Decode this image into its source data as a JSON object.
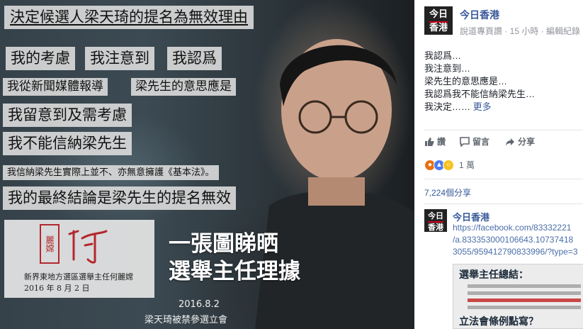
{
  "photo": {
    "title": "決定候選人梁天琦的提名為無效理由",
    "captions": [
      "我的考慮",
      "我注意到",
      "我認爲",
      "我從新聞媒體報導",
      "梁先生的意思應是",
      "我留意到及需考慮",
      "我不能信納梁先生",
      "我信納梁先生實際上並不、亦無意擁護《基本法》。",
      "我的最終結論是梁先生的提名無效"
    ],
    "seal_text": "何麗嫦",
    "signature_text": "何",
    "officer": "新界東地方選區選舉主任何麗嫦",
    "officer_date": "2016 年 8 月 2 日",
    "headline": [
      "一張圖睇晒",
      "選舉主任理據"
    ],
    "photo_date": "2016.8.2",
    "photo_subtitle": "梁天琦被禁參選立會"
  },
  "post": {
    "avatar_text": [
      "今日",
      "香港"
    ],
    "page_name": "今日香港",
    "meta": "說道專頁讚 · 15 小時 · 編輯紀錄",
    "body_lines": [
      "我認爲…",
      "我注意到…",
      "梁先生的意思應是…",
      "我認爲我不能信納梁先生…",
      "我決定……"
    ],
    "more_label": "更多",
    "actions": {
      "like": "讚",
      "comment": "留言",
      "share": "分享"
    },
    "reactions": {
      "count": "1 萬",
      "types": [
        "angry",
        "like",
        "wow"
      ]
    },
    "share_count": "7,224個分享",
    "comment": {
      "author": "今日香港",
      "link_lines": [
        "https://facebook.com/83332221",
        "/a.833353000106643.10737418",
        "3055/959412790833996/?type=3"
      ],
      "thumb_title": "選舉主任總結：",
      "thumb_question": "立法會條例點寫？"
    }
  }
}
